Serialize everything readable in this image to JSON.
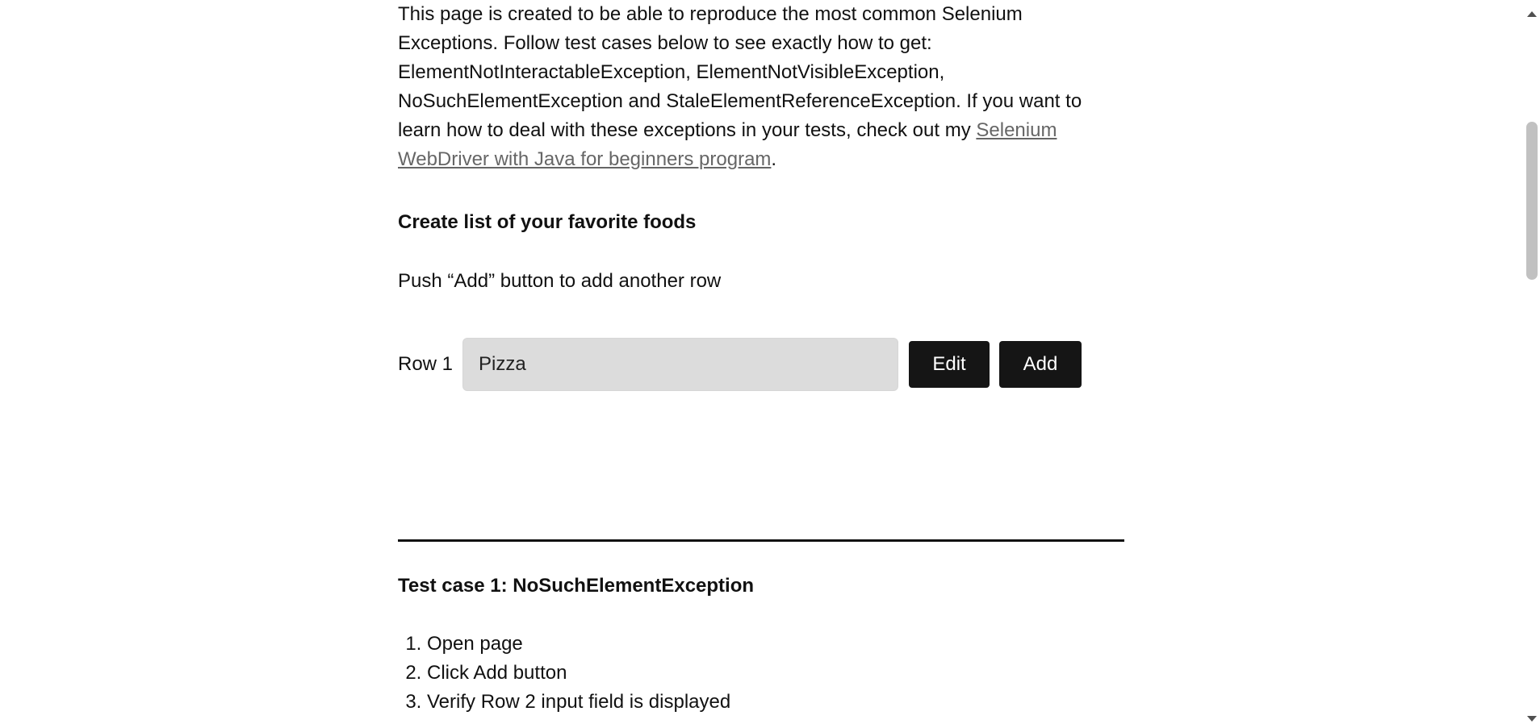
{
  "intro": {
    "text_before_link": "This page is created to be able to reproduce the most common Selenium Exceptions. Follow test cases below to see exactly how to get: ElementNotInteractableException, ElementNotVisibleException, NoSuchElementException and StaleElementReferenceException. If you want to learn how to deal with these exceptions in your tests, check out my ",
    "link_text": "Selenium WebDriver with Java for beginners program",
    "text_after_link": "."
  },
  "foods_section": {
    "heading": "Create list of your favorite foods",
    "hint": "Push “Add” button to add another row",
    "row": {
      "label": "Row 1",
      "input_value": "Pizza",
      "edit_label": "Edit",
      "add_label": "Add"
    }
  },
  "test_case_1": {
    "heading": "Test case 1: NoSuchElementException",
    "steps": [
      "Open page",
      "Click Add button",
      "Verify Row 2 input field is displayed"
    ]
  },
  "colors": {
    "button_bg": "#151515",
    "input_bg": "#dcdcdc",
    "link": "#666666"
  },
  "icons": {
    "scroll_up": "scroll-up-arrow-icon",
    "scroll_down": "scroll-down-arrow-icon"
  }
}
